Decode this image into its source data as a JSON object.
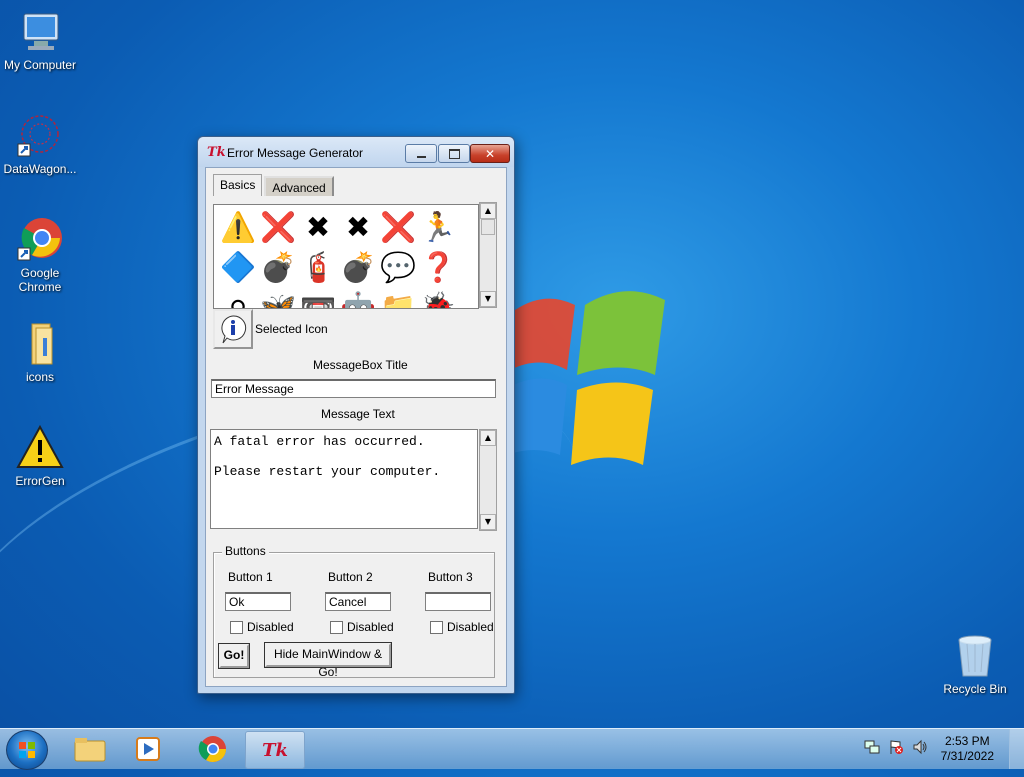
{
  "desktop": {
    "icons": [
      {
        "label": "My Computer",
        "icon": "computer-icon"
      },
      {
        "label": "DataWagon...",
        "icon": "network-shortcut-icon"
      },
      {
        "label": "Google Chrome",
        "icon": "chrome-icon"
      },
      {
        "label": "icons",
        "icon": "folder-icon"
      },
      {
        "label": "ErrorGen",
        "icon": "warning-icon"
      },
      {
        "label": "Recycle Bin",
        "icon": "recycle-bin-icon"
      }
    ]
  },
  "window": {
    "logo": "Tk",
    "title": "Error Message Generator",
    "tabs": [
      {
        "label": "Basics",
        "active": true
      },
      {
        "label": "Advanced",
        "active": false
      }
    ],
    "icon_grid": [
      "⚠️",
      "❌",
      "✖",
      "✖",
      "❌",
      "🏃",
      "🔷",
      "💣",
      "🧯",
      "💣",
      "💬",
      "❓",
      "⚪",
      "🦋",
      "📼",
      "🤖",
      "📁",
      "🐞"
    ],
    "selected_icon_label": "Selected Icon",
    "msgbox_title_label": "MessageBox Title",
    "msgbox_title_value": "Error Message",
    "message_text_label": "Message Text",
    "message_text_value": "A fatal error has occurred.\n\nPlease restart your computer.",
    "buttons_group": {
      "title": "Buttons",
      "button1_label": "Button 1",
      "button2_label": "Button 2",
      "button3_label": "Button 3",
      "button1_value": "Ok",
      "button2_value": "Cancel",
      "button3_value": "",
      "disabled_label": "Disabled",
      "go_label": "Go!",
      "hide_go_label": "Hide MainWindow & Go!"
    }
  },
  "taskbar": {
    "active_item_label": "Tk",
    "time": "2:53 PM",
    "date": "7/31/2022"
  },
  "colors": {
    "tk_red": "#c8102e",
    "close_red": "#c8412b"
  }
}
